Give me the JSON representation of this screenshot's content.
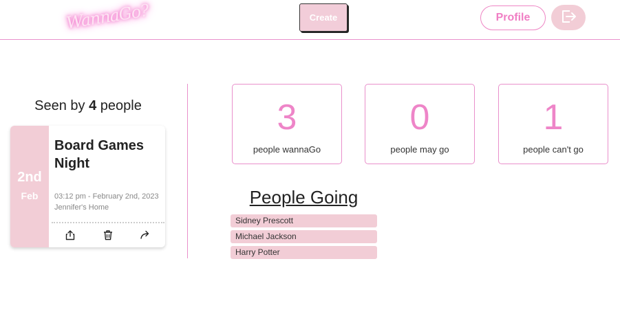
{
  "header": {
    "logo_text": "WannaGo?",
    "create_label": "Create",
    "profile_label": "Profile",
    "logout_icon": "logout-icon"
  },
  "seen": {
    "prefix": "Seen by",
    "count": "4",
    "suffix": "people"
  },
  "event": {
    "day": "2nd",
    "month": "Feb",
    "title": "Board Games Night",
    "time": "03:12 pm - February 2nd, 2023",
    "location": "Jennifer's Home",
    "actions": [
      "share-icon",
      "trash-icon",
      "forward-icon"
    ]
  },
  "stats": [
    {
      "count": "3",
      "label": "people wannaGo"
    },
    {
      "count": "0",
      "label": "people may go"
    },
    {
      "count": "1",
      "label": "people can't go"
    }
  ],
  "people_going": {
    "title": "People Going",
    "names": [
      "Sidney Prescott",
      "Michael Jackson",
      "Harry Potter"
    ]
  },
  "colors": {
    "accent_pink": "#ee85c8",
    "light_pink": "#f2cdd6",
    "border_pink": "#e98fcb"
  }
}
